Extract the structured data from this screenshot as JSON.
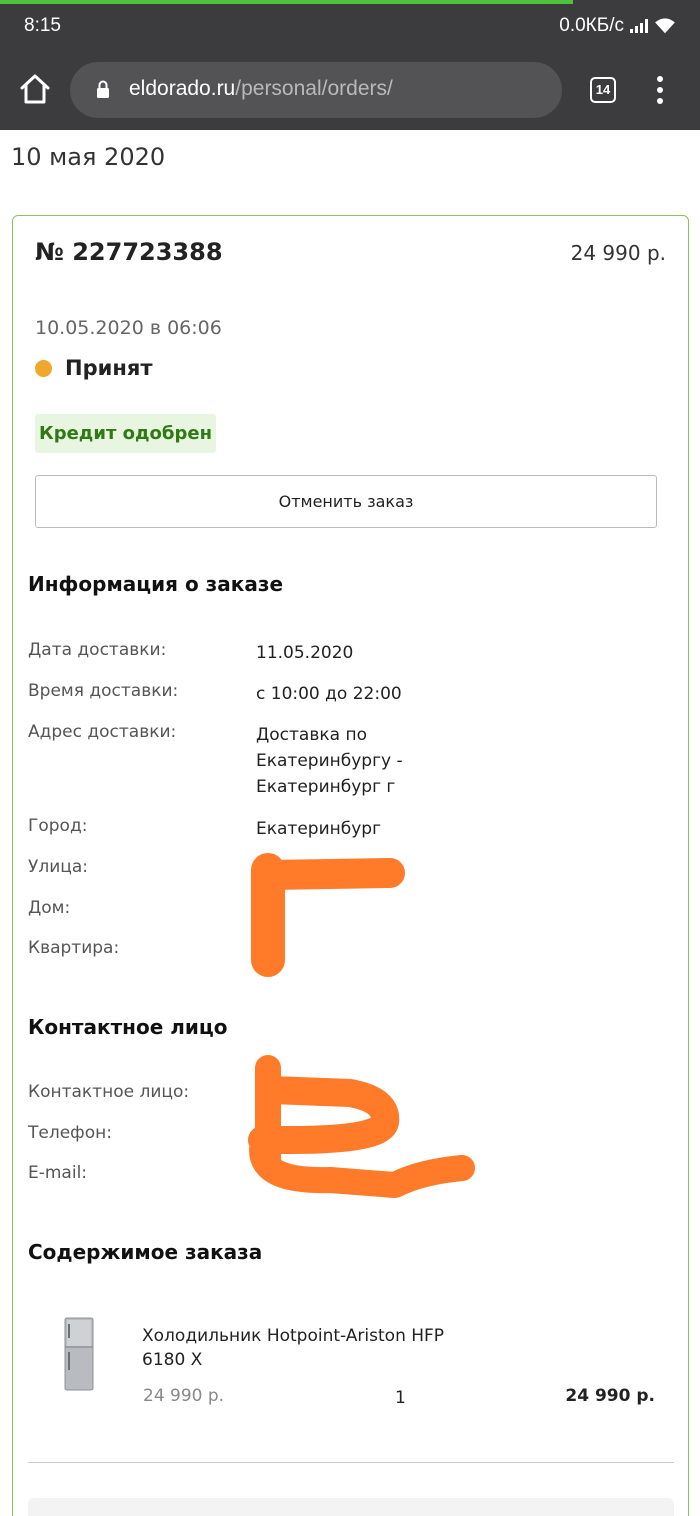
{
  "status_bar": {
    "time": "8:15",
    "net_speed": "0.0КБ/с",
    "signal_icon": "signal-icon",
    "wifi_icon": "wifi-icon"
  },
  "browser": {
    "url_domain": "eldorado.ru",
    "url_path": "/personal/orders/",
    "tab_count": "14",
    "home_icon": "home-icon",
    "lock_icon": "lock-icon",
    "menu_icon": "more-vert-icon"
  },
  "page": {
    "date_heading": "10 мая 2020"
  },
  "order": {
    "number": "№ 227723388",
    "total": "24 990 р.",
    "datetime": "10.05.2020 в 06:06",
    "status": "Принят",
    "status_color": "#f1a72b",
    "credit_badge": "Кредит одобрен",
    "cancel_label": "Отменить заказ"
  },
  "order_info": {
    "title": "Информация о заказе",
    "delivery_date_label": "Дата доставки:",
    "delivery_date": "11.05.2020",
    "delivery_time_label": "Время доставки:",
    "delivery_time": "с 10:00 до 22:00",
    "address_label": "Адрес доставки:",
    "address_line1": "Доставка по",
    "address_line2": "Екатеринбургу -",
    "address_line3": "Екатеринбург г",
    "city_label": "Город:",
    "city": "Екатеринбург",
    "street_label": "Улица:",
    "house_label": "Дом:",
    "apartment_label": "Квартира:"
  },
  "contact": {
    "title": "Контактное лицо",
    "person_label": "Контактное лицо:",
    "phone_label": "Телефон:",
    "email_label": "E-mail:"
  },
  "contents": {
    "title": "Содержимое заказа",
    "item_name": "Холодильник Hotpoint-Ariston HFP 6180 X",
    "item_price": "24 990 р.",
    "item_qty": "1",
    "item_sum": "24 990 р.",
    "item_icon": "fridge-icon"
  },
  "colors": {
    "accent_green": "#8ac35a",
    "badge_green": "#2f7a14",
    "redaction_orange": "#ff7a29"
  }
}
